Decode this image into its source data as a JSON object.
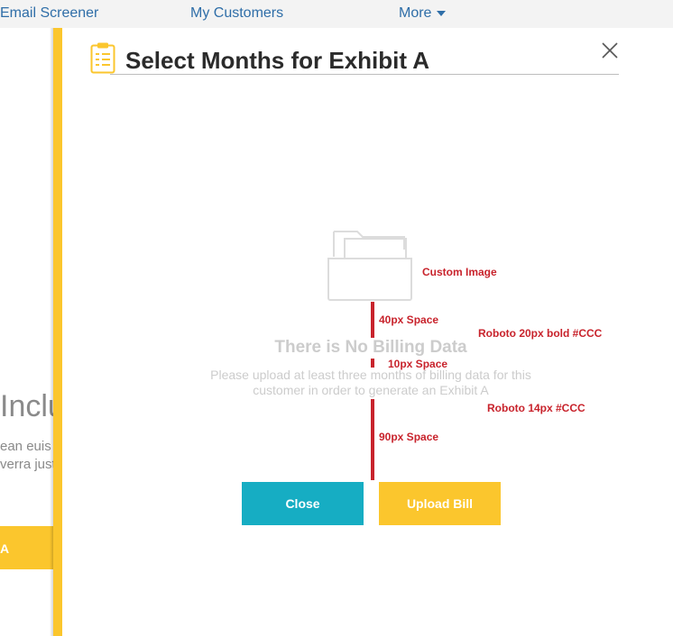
{
  "nav": {
    "items": [
      "Email Screener",
      "My Customers"
    ],
    "more_label": "More"
  },
  "background": {
    "heading": "Inclu",
    "line1": "ean euis",
    "line2": "verra just",
    "button_label": "A"
  },
  "modal": {
    "title": "Select Months for Exhibit A",
    "empty_title": "There is No Billing Data",
    "empty_body": "Please upload at least three months of billing data for this customer in order to generate an Exhibit A",
    "close_button": "Close",
    "upload_button": "Upload Bill"
  },
  "annotations": {
    "custom_image": "Custom Image",
    "space_40": "40px Space",
    "title_spec": "Roboto 20px bold #CCC",
    "space_10": "10px Space",
    "body_spec": "Roboto 14px #CCC",
    "space_90": "90px Space"
  },
  "colors": {
    "accent_yellow": "#fbc62d",
    "close_teal": "#16adc3",
    "annotation_red": "#c8232c",
    "nav_blue": "#2f6ea8",
    "empty_gray": "#cccccc"
  },
  "icons": [
    "chevron-down-icon",
    "clipboard-icon",
    "close-icon",
    "folder-icon"
  ]
}
